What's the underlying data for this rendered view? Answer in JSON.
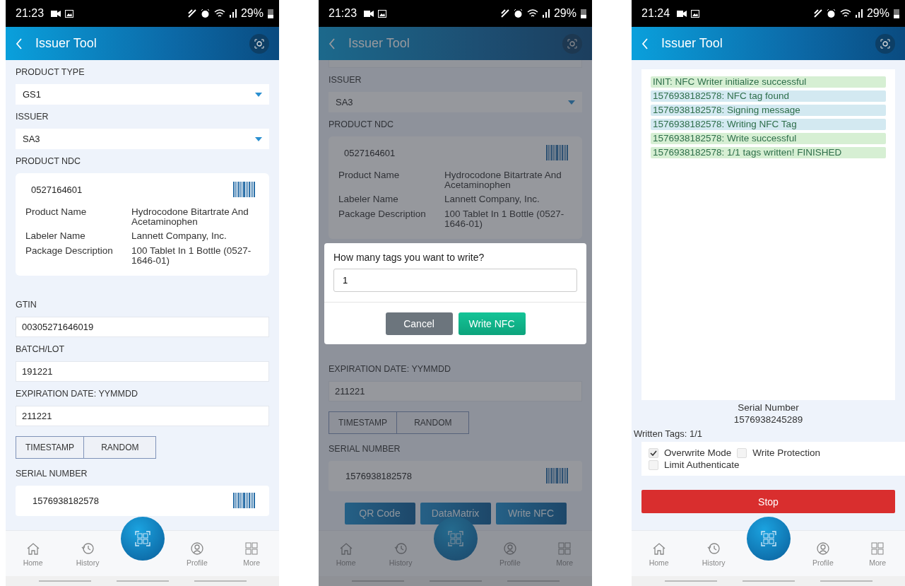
{
  "screens": [
    {
      "dimmed": false,
      "status_bar": {
        "time": "21:23",
        "battery": "29%"
      },
      "header": {
        "title": "Issuer Tool"
      },
      "content": [
        {
          "kind": "label",
          "text": "PRODUCT TYPE"
        },
        {
          "kind": "select",
          "value": "GS1"
        },
        {
          "kind": "label",
          "text": "ISSUER"
        },
        {
          "kind": "select",
          "value": "SA3"
        },
        {
          "kind": "label",
          "text": "PRODUCT NDC"
        },
        {
          "kind": "product_card",
          "ndc": "0527164601",
          "details": [
            {
              "label": "Product Name",
              "value": "Hydrocodone Bitartrate And Acetaminophen"
            },
            {
              "label": "Labeler Name",
              "value": "Lannett Company, Inc."
            },
            {
              "label": "Package Description",
              "value": "100 Tablet In 1 Bottle (0527-1646-01)"
            }
          ]
        },
        {
          "kind": "label",
          "text": "GTIN"
        },
        {
          "kind": "input",
          "value": "00305271646019"
        },
        {
          "kind": "label",
          "text": "BATCH/LOT"
        },
        {
          "kind": "input",
          "value": "191221"
        },
        {
          "kind": "label",
          "text": "EXPIRATION DATE: YYMMDD"
        },
        {
          "kind": "input",
          "value": "211221"
        },
        {
          "kind": "segmented",
          "options": [
            "TIMESTAMP",
            "RANDOM"
          ]
        },
        {
          "kind": "label",
          "text": "SERIAL NUMBER"
        },
        {
          "kind": "serial_card",
          "value": "1576938182578"
        }
      ],
      "nav": [
        {
          "kind": "home",
          "label": "Home"
        },
        {
          "kind": "history",
          "label": "History"
        },
        {
          "kind": "scan"
        },
        {
          "kind": "profile",
          "label": "Profile"
        },
        {
          "kind": "more",
          "label": "More"
        }
      ]
    },
    {
      "dimmed": true,
      "status_bar": {
        "time": "21:23",
        "battery": "29%"
      },
      "header": {
        "title": "Issuer Tool"
      },
      "content": [
        {
          "kind": "clipped_select"
        },
        {
          "kind": "label",
          "text": "ISSUER"
        },
        {
          "kind": "select",
          "value": "SA3"
        },
        {
          "kind": "label",
          "text": "PRODUCT NDC"
        },
        {
          "kind": "product_card",
          "ndc": "0527164601",
          "details": [
            {
              "label": "Product Name",
              "value": "Hydrocodone Bitartrate And Acetaminophen"
            },
            {
              "label": "Labeler Name",
              "value": "Lannett Company, Inc."
            },
            {
              "label": "Package Description",
              "value": "100 Tablet In 1 Bottle (0527-1646-01)"
            }
          ]
        },
        {
          "kind": "dialog",
          "question": "How many tags you want to write?",
          "value": "1",
          "buttons": [
            {
              "kind": "cancel",
              "label": "Cancel"
            },
            {
              "kind": "confirm",
              "label": "Write NFC"
            }
          ]
        },
        {
          "kind": "label",
          "text": "EXPIRATION DATE: YYMMDD"
        },
        {
          "kind": "input",
          "value": "211221"
        },
        {
          "kind": "segmented",
          "options": [
            "TIMESTAMP",
            "RANDOM"
          ]
        },
        {
          "kind": "label",
          "text": "SERIAL NUMBER"
        },
        {
          "kind": "serial_card",
          "value": "1576938182578"
        },
        {
          "kind": "action_buttons",
          "buttons": [
            "QR Code",
            "DataMatrix",
            "Write NFC"
          ]
        }
      ],
      "nav": [
        {
          "kind": "home",
          "label": "Home"
        },
        {
          "kind": "history",
          "label": "History"
        },
        {
          "kind": "scan"
        },
        {
          "kind": "profile",
          "label": "Profile"
        },
        {
          "kind": "more",
          "label": "More"
        }
      ]
    },
    {
      "dimmed": false,
      "status_bar": {
        "time": "21:24",
        "battery": "29%"
      },
      "header": {
        "title": "Issuer Tool"
      },
      "content": [
        {
          "kind": "log",
          "entries": [
            {
              "text": "INIT: NFC Writer initialize successful",
              "color": "#d6efd3"
            },
            {
              "text": "1576938182578: NFC tag found",
              "color": "#d3e9f1"
            },
            {
              "text": "1576938182578: Signing message",
              "color": "#d3e9f1"
            },
            {
              "text": "1576938182578: Writing NFC Tag",
              "color": "#d3e9f1"
            },
            {
              "text": "1576938182578: Write successful",
              "color": "#d6efd3"
            },
            {
              "text": "1576938182578: 1/1 tags written! FINISHED",
              "color": "#d6efd3"
            }
          ]
        },
        {
          "kind": "serial_info",
          "label": "Serial Number",
          "value": "1576938245289"
        },
        {
          "kind": "text",
          "text": "Written Tags: 1/1"
        },
        {
          "kind": "options",
          "items": [
            {
              "label": "Overwrite Mode",
              "checked": true
            },
            {
              "label": "Write Protection",
              "checked": false
            },
            {
              "label": "Limit Authenticate",
              "checked": false
            }
          ]
        },
        {
          "kind": "stop_button",
          "label": "Stop"
        }
      ],
      "nav": [
        {
          "kind": "home",
          "label": "Home"
        },
        {
          "kind": "history",
          "label": "History"
        },
        {
          "kind": "scan"
        },
        {
          "kind": "profile",
          "label": "Profile"
        },
        {
          "kind": "more",
          "label": "More"
        }
      ]
    }
  ]
}
